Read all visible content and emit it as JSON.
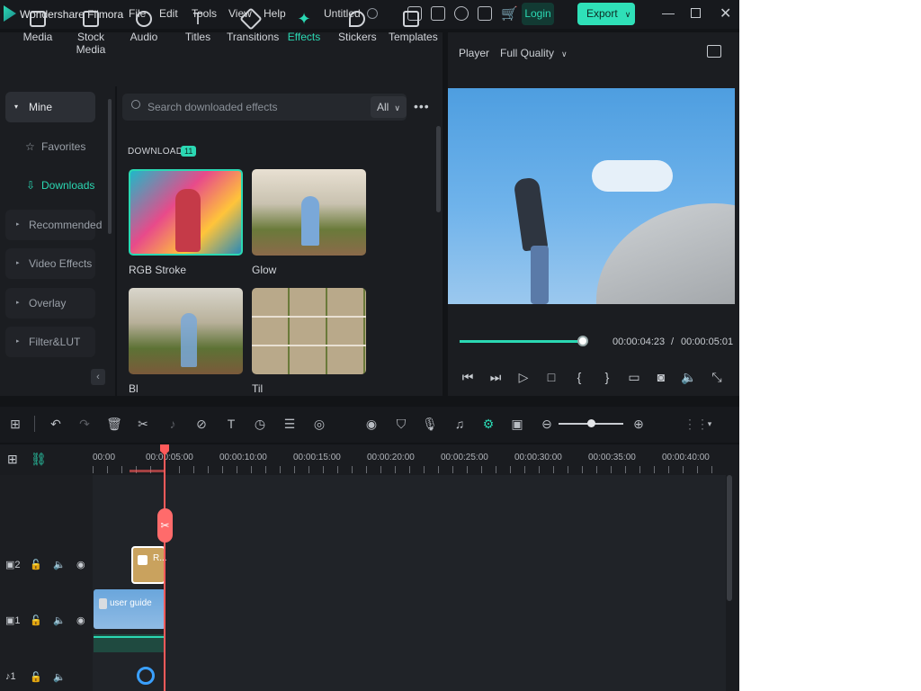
{
  "app": {
    "title": "Wondershare Filmora",
    "project": "Untitled",
    "login": "Login",
    "export": "Export"
  },
  "menu": [
    "File",
    "Edit",
    "Tools",
    "View",
    "Help"
  ],
  "toolbar": [
    {
      "label": "Media",
      "icon": "media-icon"
    },
    {
      "label": "Stock Media",
      "icon": "stock-media-icon"
    },
    {
      "label": "Audio",
      "icon": "audio-icon"
    },
    {
      "label": "Titles",
      "icon": "titles-icon"
    },
    {
      "label": "Transitions",
      "icon": "transitions-icon"
    },
    {
      "label": "Effects",
      "icon": "effects-icon",
      "active": true
    },
    {
      "label": "Stickers",
      "icon": "stickers-icon"
    },
    {
      "label": "Templates",
      "icon": "templates-icon"
    }
  ],
  "sidebar": {
    "items": [
      "Mine",
      "Favorites",
      "Downloads",
      "Recommended",
      "Video Effects",
      "Overlay",
      "Filter&LUT"
    ]
  },
  "effects": {
    "search_placeholder": "Search downloaded effects",
    "filter": "All",
    "section": "DOWNLOADS",
    "count": "11",
    "items": [
      "RGB Stroke",
      "Glow",
      "Bl",
      "Til"
    ]
  },
  "player": {
    "label": "Player",
    "quality": "Full Quality",
    "current_time": "00:00:04:23",
    "separator": "/",
    "total_time": "00:00:05:01",
    "progress": 0.96
  },
  "timeline": {
    "ticks": [
      "00:00",
      "00:00:05:00",
      "00:00:10:00",
      "00:00:15:00",
      "00:00:20:00",
      "00:00:25:00",
      "00:00:30:00",
      "00:00:35:00",
      "00:00:40:00"
    ],
    "tracks": [
      "2",
      "1",
      "1"
    ],
    "effect_clip": "R...",
    "video_clip": "user guide"
  },
  "colors": {
    "accent": "#2bd8b3",
    "playhead": "#ff5a5a",
    "export": "#2fe0b8"
  }
}
